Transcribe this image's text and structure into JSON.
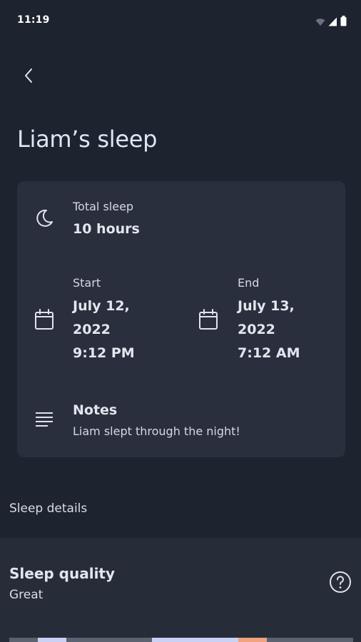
{
  "status_bar": {
    "time": "11:19",
    "icons": [
      "wifi-icon",
      "signal-icon",
      "battery-icon"
    ]
  },
  "header": {
    "back_icon": "chevron-left-icon",
    "title": "Liam’s sleep"
  },
  "card": {
    "total_sleep": {
      "icon": "moon-icon",
      "label": "Total sleep",
      "value": "10 hours"
    },
    "start": {
      "icon": "calendar-icon",
      "label": "Start",
      "date_line1": "July 12,",
      "date_line2": "2022",
      "time": "9:12 PM"
    },
    "end": {
      "icon": "calendar-icon",
      "label": "End",
      "date_line1": "July 13,",
      "date_line2": "2022",
      "time": "7:12 AM"
    },
    "notes": {
      "icon": "notes-lines-icon",
      "label": "Notes",
      "text": "Liam slept through the night!"
    }
  },
  "details": {
    "section_label": "Sleep details",
    "quality": {
      "title": "Sleep quality",
      "value": "Great",
      "help_icon": "help-circle-icon"
    },
    "quality_bar_colors": [
      "#5b6270",
      "#c9d2f5",
      "#5b6270",
      "#c9d2f5",
      "#f0a37e",
      "#5b6270"
    ]
  },
  "colors": {
    "background": "#1d2430",
    "card": "#2a2f3d",
    "panel": "#272c39",
    "text": "#e3e6ee"
  }
}
